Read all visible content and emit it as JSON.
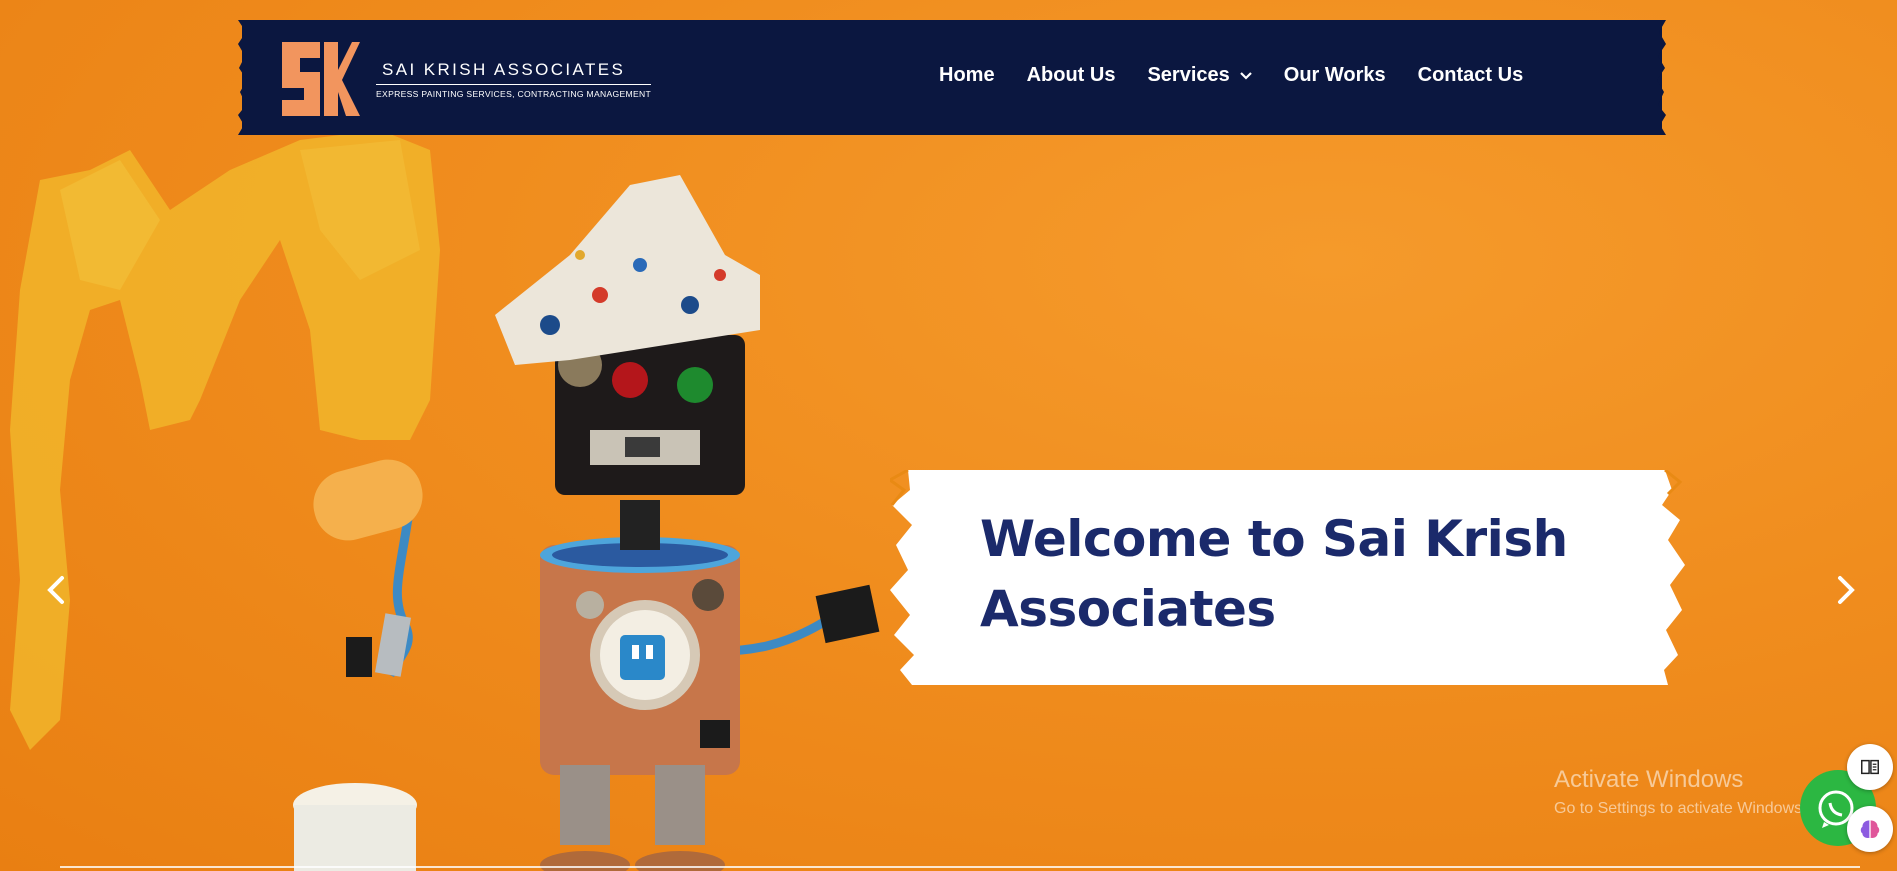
{
  "brand": {
    "name": "SAI KRISH ASSOCIATES",
    "tagline": "EXPRESS PAINTING SERVICES, CONTRACTING MANAGEMENT",
    "logo_color": "#f2955e"
  },
  "nav": {
    "items": [
      {
        "label": "Home"
      },
      {
        "label": "About Us"
      },
      {
        "label": "Services"
      },
      {
        "label": "Our Works"
      },
      {
        "label": "Contact Us"
      }
    ]
  },
  "hero": {
    "title": "Welcome to Sai Krish Associates",
    "title_color": "#1b2a6b"
  },
  "watermark": {
    "title": "Activate Windows",
    "subtitle": "Go to Settings to activate Windows."
  },
  "icons": {
    "prev": "chevron-left-icon",
    "next": "chevron-right-icon",
    "whatsapp": "whatsapp-icon",
    "reader": "book-icon",
    "assistant": "brain-icon"
  },
  "colors": {
    "header_bg": "#0b1740",
    "hero_bg": "#f08d1e",
    "whatsapp": "#2cb742"
  }
}
